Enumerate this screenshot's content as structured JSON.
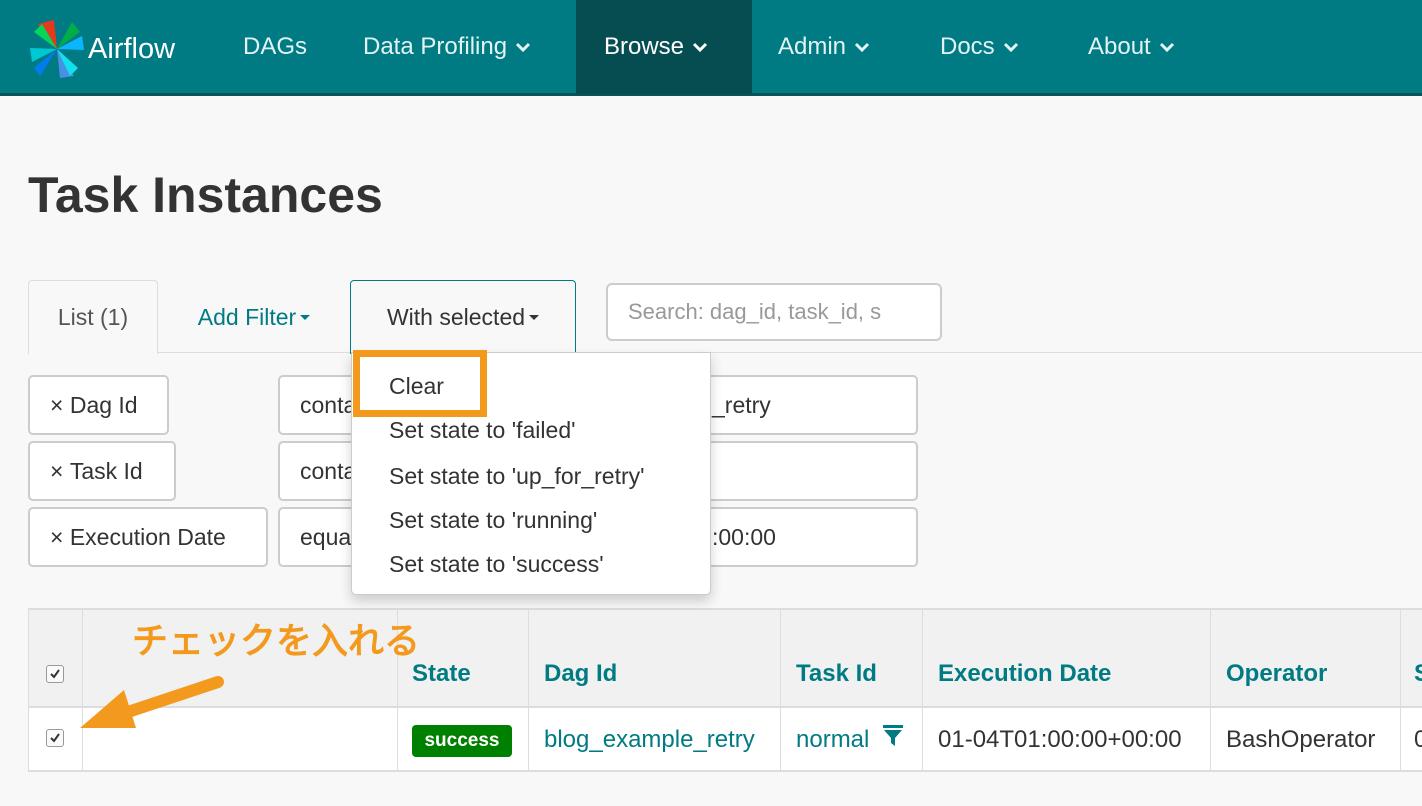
{
  "navbar": {
    "brand": "Airflow",
    "items": [
      {
        "label": "DAGs",
        "dropdown": false
      },
      {
        "label": "Data Profiling",
        "dropdown": true
      },
      {
        "label": "Browse",
        "dropdown": true,
        "active": true
      },
      {
        "label": "Admin",
        "dropdown": true
      },
      {
        "label": "Docs",
        "dropdown": true
      },
      {
        "label": "About",
        "dropdown": true
      }
    ]
  },
  "page": {
    "title": "Task Instances"
  },
  "tabs": {
    "list": "List (1)",
    "add_filter": "Add Filter",
    "with_selected": "With selected"
  },
  "search": {
    "placeholder": "Search: dag_id, task_id, s"
  },
  "filters": [
    {
      "label": "Dag Id",
      "operator": "conta",
      "value": "_retry"
    },
    {
      "label": "Task Id",
      "operator": "conta",
      "value": ""
    },
    {
      "label": "Execution Date",
      "operator": "equa",
      "value": ":00:00"
    }
  ],
  "dropdown": {
    "items": [
      "Clear",
      "Set state to 'failed'",
      "Set state to 'up_for_retry'",
      "Set state to 'running'",
      "Set state to 'success'"
    ],
    "highlighted": "Clear"
  },
  "table": {
    "headers": [
      "State",
      "Dag Id",
      "Task Id",
      "Execution Date",
      "Operator",
      "S"
    ],
    "row": {
      "checked": true,
      "state": "success",
      "dag_id": "blog_example_retry",
      "task_id": "normal",
      "execution_date": "01-04T01:00:00+00:00",
      "operator": "BashOperator",
      "extra": "0"
    }
  },
  "annotation": {
    "text": "チェックを入れる"
  },
  "colors": {
    "navbar": "#017b83",
    "navbar_active": "#054d51",
    "link": "#017b83",
    "success": "#008000",
    "highlight": "#f39a1e"
  }
}
